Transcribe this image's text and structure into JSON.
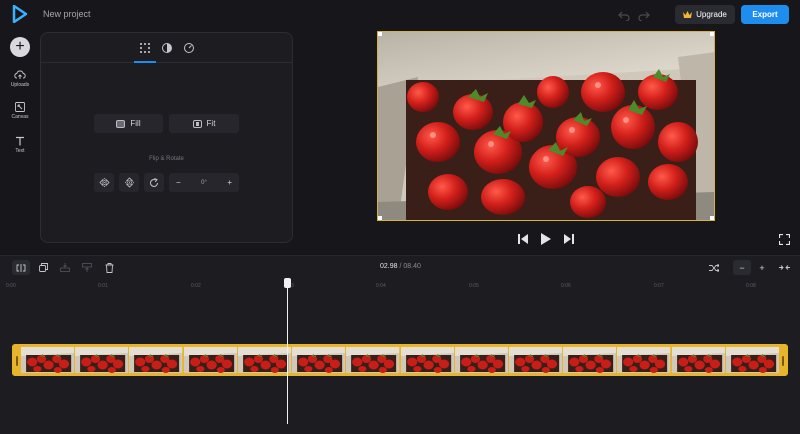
{
  "header": {
    "project_title": "New project",
    "upgrade_label": "Upgrade",
    "export_label": "Export"
  },
  "rail": {
    "add_label": "+",
    "items": [
      {
        "label": "Uploads",
        "icon": "upload-cloud-icon"
      },
      {
        "label": "Canvas",
        "icon": "canvas-resize-icon"
      },
      {
        "label": "Text",
        "icon": "text-icon"
      }
    ]
  },
  "panel": {
    "tabs": [
      {
        "icon": "grid-dots-icon",
        "active": true
      },
      {
        "icon": "contrast-icon",
        "active": false
      },
      {
        "icon": "speed-gauge-icon",
        "active": false
      }
    ],
    "fill_label": "Fill",
    "fit_label": "Fit",
    "flip_rotate_label": "Flip & Rotate",
    "rotation_value": "0°",
    "minus_label": "−",
    "plus_label": "+"
  },
  "timeline": {
    "current_time": "02.98",
    "separator": "/",
    "duration": "08.40",
    "ruler_ticks": [
      "0:00",
      "0:01",
      "0:02",
      "0:03",
      "0:04",
      "0:05",
      "0:06",
      "0:07",
      "0:08"
    ],
    "zoom_minus": "−",
    "zoom_plus": "+",
    "thumbnail_count": 14
  },
  "colors": {
    "accent": "#1e8df0",
    "clip_border": "#e8b52a",
    "preview_border": "#d9b339",
    "background": "#17171b"
  }
}
